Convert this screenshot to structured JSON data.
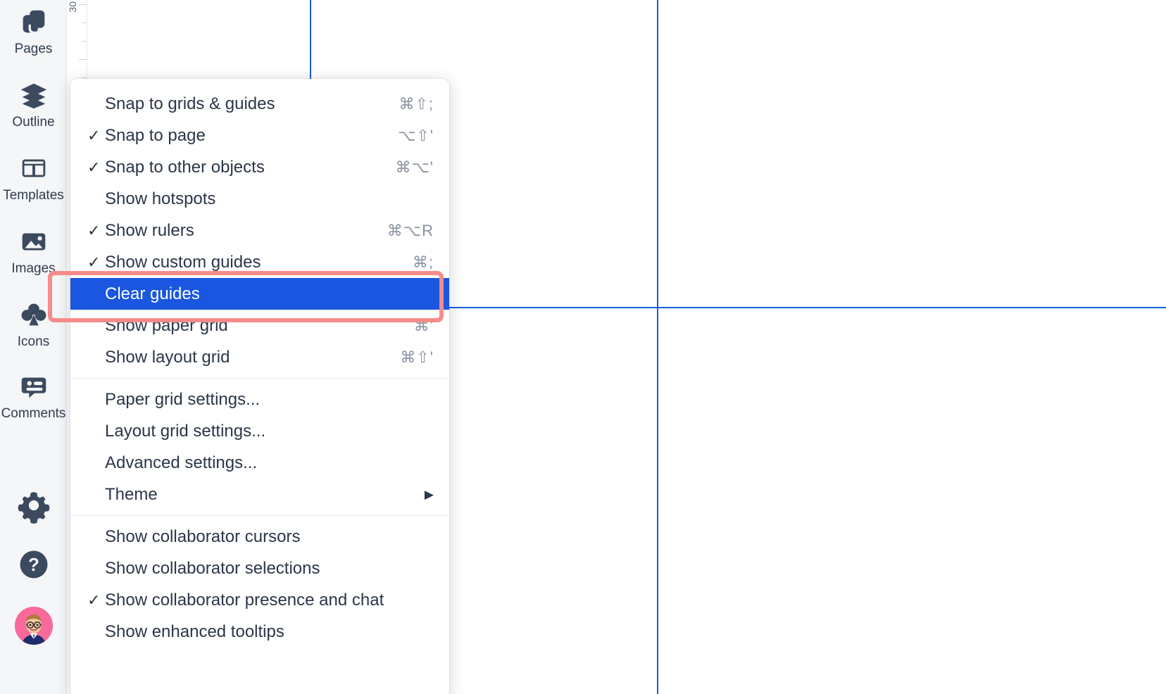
{
  "sidebar": {
    "items": [
      {
        "label": "Pages",
        "icon": "pages-icon"
      },
      {
        "label": "Outline",
        "icon": "layers-icon"
      },
      {
        "label": "Templates",
        "icon": "templates-icon"
      },
      {
        "label": "Images",
        "icon": "image-icon"
      },
      {
        "label": "Icons",
        "icon": "club-icon"
      },
      {
        "label": "Comments",
        "icon": "comment-icon"
      }
    ],
    "bottom": [
      {
        "name": "settings-button",
        "icon": "gear-icon"
      },
      {
        "name": "help-button",
        "icon": "question-circle-icon"
      },
      {
        "name": "user-avatar",
        "icon": "avatar"
      }
    ]
  },
  "ruler": {
    "orientation": "vertical",
    "visible_label": "30"
  },
  "canvas": {
    "background": "#ffffff",
    "guide_color": "#1d5de0",
    "guides": {
      "vertical": [
        440,
        933
      ],
      "horizontal": [
        437
      ]
    }
  },
  "menu": {
    "name": "view-context-menu",
    "selected_item": "Clear guides",
    "highlight_color": "#1a56e0",
    "annotation_color": "#f98b8b",
    "groups": [
      {
        "items": [
          {
            "label": "Snap to grids & guides",
            "checked": false,
            "shortcut": "⌘⇧;"
          },
          {
            "label": "Snap to page",
            "checked": true,
            "shortcut": "⌥⇧'"
          },
          {
            "label": "Snap to other objects",
            "checked": true,
            "shortcut": "⌘⌥'"
          },
          {
            "label": "Show hotspots",
            "checked": false,
            "shortcut": ""
          },
          {
            "label": "Show rulers",
            "checked": true,
            "shortcut": "⌘⌥R"
          },
          {
            "label": "Show custom guides",
            "checked": true,
            "shortcut": "⌘;"
          },
          {
            "label": "Clear guides",
            "checked": false,
            "shortcut": "",
            "selected": true
          },
          {
            "label": "Show paper grid",
            "checked": false,
            "shortcut": "⌘'"
          },
          {
            "label": "Show layout grid",
            "checked": false,
            "shortcut": "⌘⇧'"
          }
        ]
      },
      {
        "items": [
          {
            "label": "Paper grid settings...",
            "checked": false,
            "shortcut": ""
          },
          {
            "label": "Layout grid settings...",
            "checked": false,
            "shortcut": ""
          },
          {
            "label": "Advanced settings...",
            "checked": false,
            "shortcut": ""
          },
          {
            "label": "Theme",
            "checked": false,
            "shortcut": "",
            "submenu": true,
            "arrow": "▶"
          }
        ]
      },
      {
        "items": [
          {
            "label": "Show collaborator cursors",
            "checked": false,
            "shortcut": ""
          },
          {
            "label": "Show collaborator selections",
            "checked": false,
            "shortcut": ""
          },
          {
            "label": "Show collaborator presence and chat",
            "checked": true,
            "shortcut": ""
          },
          {
            "label": "Show enhanced tooltips",
            "checked": false,
            "shortcut": ""
          }
        ]
      }
    ],
    "check_glyph": "✓"
  }
}
